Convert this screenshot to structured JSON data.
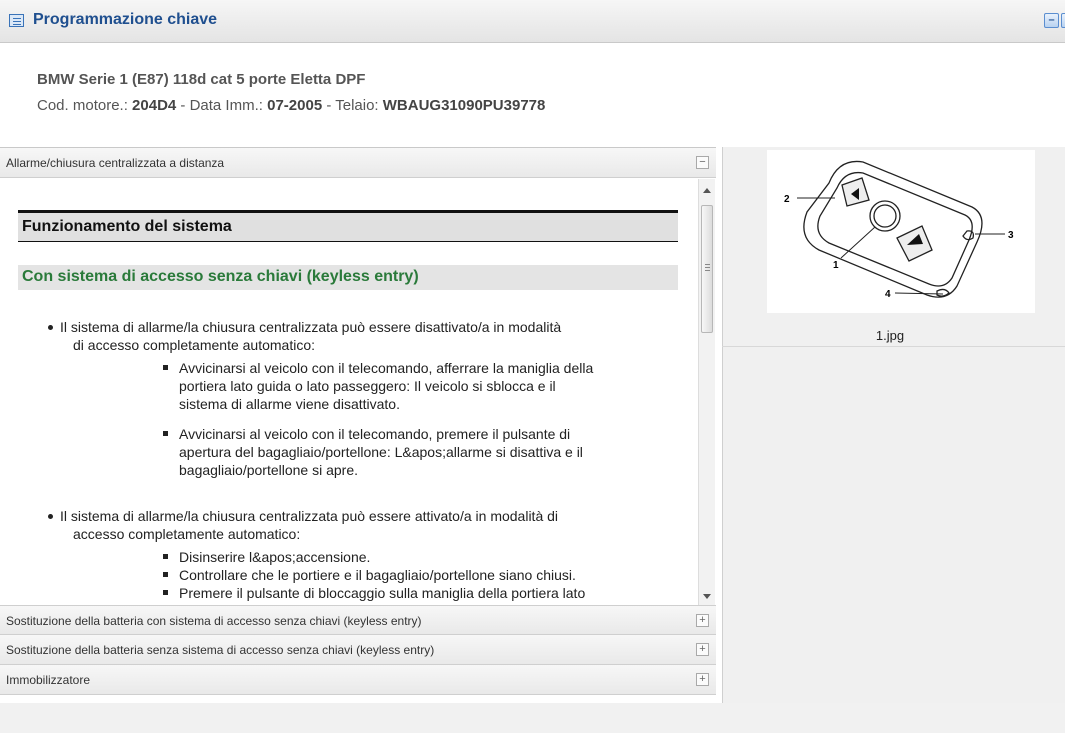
{
  "window": {
    "title": "Programmazione chiave",
    "minimize_label": "–",
    "close_label": "x"
  },
  "vehicle": {
    "name": "BMW Serie 1 (E87) 118d cat 5 porte Eletta DPF",
    "engine_label": "Cod. motore.:",
    "engine_code": "204D4",
    "date_label": " - Data Imm.:",
    "date": "07-2005",
    "chassis_label": " - Telaio:",
    "chassis": "WBAUG31090PU39778"
  },
  "accordion": [
    {
      "label": "Allarme/chiusura centralizzata a distanza",
      "toggle": "−",
      "expanded": true
    },
    {
      "label": "Sostituzione della batteria con sistema di accesso senza chiavi (keyless entry)",
      "toggle": "+",
      "expanded": false
    },
    {
      "label": "Sostituzione della batteria senza sistema di accesso senza chiavi (keyless entry)",
      "toggle": "+",
      "expanded": false
    },
    {
      "label": "Immobilizzatore",
      "toggle": "+",
      "expanded": false
    }
  ],
  "content": {
    "section_title": "Funzionamento del sistema",
    "subtitle": "Con sistema di accesso senza chiavi (keyless entry)",
    "bullet1": {
      "line1": "Il sistema di allarme/la chiusura centralizzata può essere disattivato/a in modalità",
      "line2": "di accesso completamente automatico:",
      "sub1": [
        "Avvicinarsi al veicolo con il telecomando, afferrare la maniglia della",
        "portiera lato guida o lato passeggero: Il veicolo si sblocca e il",
        "sistema di allarme viene disattivato."
      ],
      "sub2": [
        "Avvicinarsi al veicolo con il telecomando, premere il pulsante di",
        "apertura del bagagliaio/portellone: L&apos;allarme si disattiva e il",
        "bagagliaio/portellone si apre."
      ]
    },
    "bullet2": {
      "line1": "Il sistema di allarme/la chiusura centralizzata può essere attivato/a in modalità di",
      "line2": "accesso completamente automatico:",
      "sub1": "Disinserire l&apos;accensione.",
      "sub2": "Controllare che le portiere e il bagagliaio/portellone siano chiusi.",
      "sub3": "Premere il pulsante di bloccaggio sulla maniglia della portiera lato"
    }
  },
  "image": {
    "caption": "1.jpg",
    "callouts": [
      "1",
      "2",
      "3",
      "4"
    ],
    "icon": "key-fob-diagram"
  }
}
